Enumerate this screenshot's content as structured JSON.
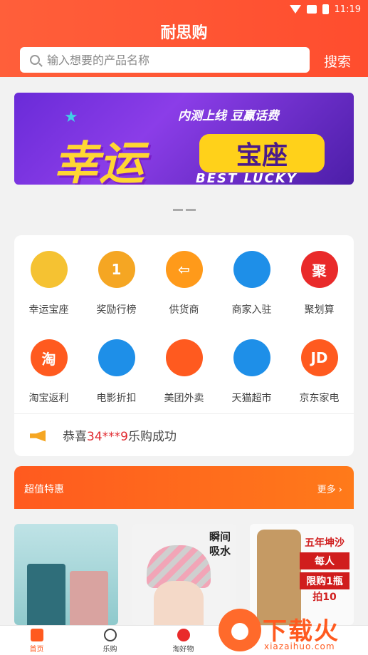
{
  "statusbar": {
    "time": "11:19"
  },
  "header": {
    "title": "耐思购",
    "search_placeholder": "输入想要的产品名称",
    "search_button": "搜索"
  },
  "banner": {
    "subtitle": "内测上线  豆赢话费",
    "big_text": "幸运",
    "pill_text": "宝座",
    "english": "BEST LUCKY"
  },
  "grid": {
    "items": [
      {
        "label": "幸运宝座",
        "icon": "crown-icon",
        "color": "#f5c232"
      },
      {
        "label": "奖励行榜",
        "icon": "medal-icon",
        "color": "#f5a623"
      },
      {
        "label": "供货商",
        "icon": "supplier-icon",
        "color": "#ff9a1a"
      },
      {
        "label": "商家入驻",
        "icon": "store-icon",
        "color": "#1e8fe8"
      },
      {
        "label": "聚划算",
        "icon": "ju-icon",
        "color": "#e92a2a"
      },
      {
        "label": "淘宝返利",
        "icon": "taobao-icon",
        "color": "#ff5a1f"
      },
      {
        "label": "电影折扣",
        "icon": "film-icon",
        "color": "#1e8fe8"
      },
      {
        "label": "美团外卖",
        "icon": "meituan-icon",
        "color": "#ff5a1f"
      },
      {
        "label": "天猫超市",
        "icon": "tmall-bag-icon",
        "color": "#1e8fe8"
      },
      {
        "label": "京东家电",
        "icon": "jd-icon",
        "color": "#ff5a1f"
      }
    ],
    "glyphs": [
      "",
      "1",
      "⇦",
      "",
      "聚",
      "淘",
      "",
      "",
      "",
      "JD"
    ]
  },
  "notice": {
    "prefix": "恭喜",
    "number": "34***9",
    "suffix": "乐购成功"
  },
  "deal": {
    "title": "超值特惠",
    "more": "更多 ›"
  },
  "products": {
    "p2_line1": "瞬间",
    "p2_line2": "吸水",
    "p3_line1": "五年坤沙",
    "p3_line2": "每人",
    "p3_line3": "限购1瓶",
    "p3_line4": "拍10"
  },
  "tabbar": {
    "tabs": [
      {
        "label": "首页"
      },
      {
        "label": "乐购"
      },
      {
        "label": "淘好物"
      }
    ]
  },
  "watermark": {
    "title": "下载火",
    "url": "xiazaihuo.com"
  }
}
